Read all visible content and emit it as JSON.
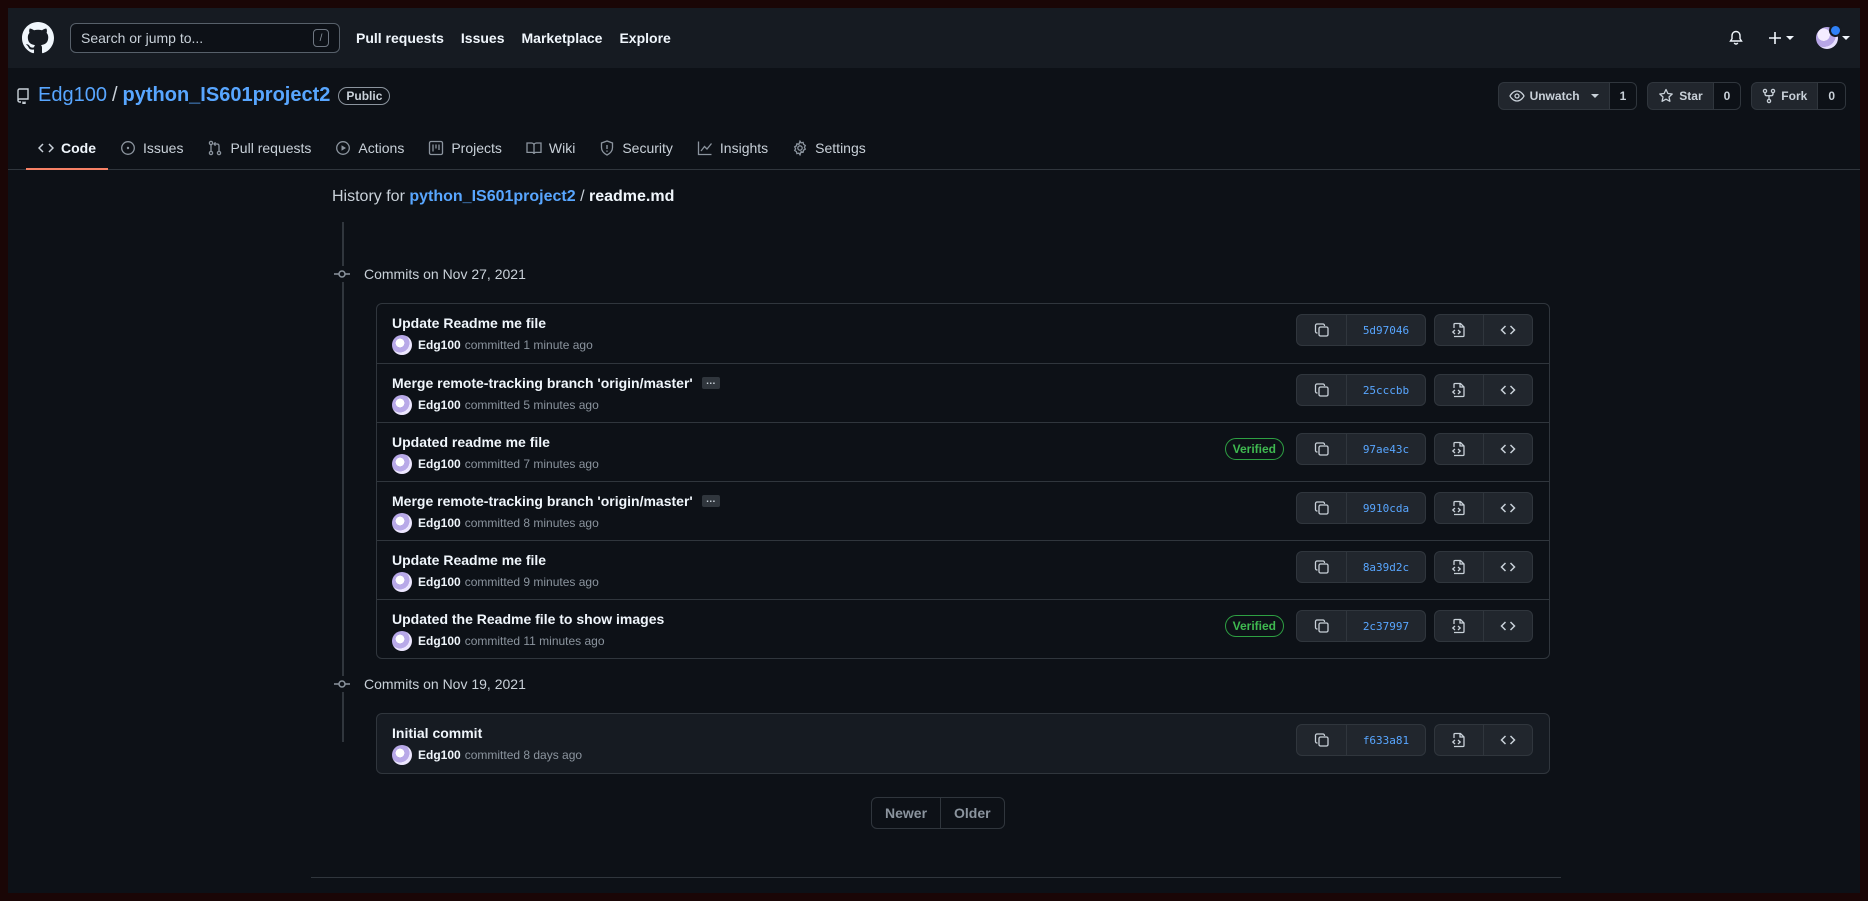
{
  "header": {
    "search_placeholder": "Search or jump to...",
    "search_shortcut": "/",
    "nav": [
      "Pull requests",
      "Issues",
      "Marketplace",
      "Explore"
    ]
  },
  "repo": {
    "owner": "Edg100",
    "separator": "/",
    "name": "python_IS601project2",
    "visibility": "Public",
    "watch_label": "Unwatch",
    "watch_count": "1",
    "star_label": "Star",
    "star_count": "0",
    "fork_label": "Fork",
    "fork_count": "0"
  },
  "tabs": [
    {
      "label": "Code",
      "icon": "code-icon",
      "selected": true
    },
    {
      "label": "Issues",
      "icon": "issue-icon"
    },
    {
      "label": "Pull requests",
      "icon": "pull-request-icon"
    },
    {
      "label": "Actions",
      "icon": "play-icon"
    },
    {
      "label": "Projects",
      "icon": "project-icon"
    },
    {
      "label": "Wiki",
      "icon": "book-icon"
    },
    {
      "label": "Security",
      "icon": "shield-icon"
    },
    {
      "label": "Insights",
      "icon": "graph-icon"
    },
    {
      "label": "Settings",
      "icon": "gear-icon"
    }
  ],
  "history": {
    "prefix": "History for",
    "repo_link": "python_IS601project2",
    "sep": "/",
    "file": "readme.md"
  },
  "groups": [
    {
      "date": "Commits on Nov 27, 2021",
      "commits": [
        {
          "message": "Update Readme me file",
          "author": "Edg100",
          "time": "committed 1 minute ago",
          "sha": "5d97046"
        },
        {
          "message": "Merge remote-tracking branch 'origin/master'",
          "ellipsis": "…",
          "author": "Edg100",
          "time": "committed 5 minutes ago",
          "sha": "25cccbb"
        },
        {
          "message": "Updated readme me file",
          "author": "Edg100",
          "time": "committed 7 minutes ago",
          "sha": "97ae43c",
          "verified": "Verified"
        },
        {
          "message": "Merge remote-tracking branch 'origin/master'",
          "ellipsis": "…",
          "author": "Edg100",
          "time": "committed 8 minutes ago",
          "sha": "9910cda"
        },
        {
          "message": "Update Readme me file",
          "author": "Edg100",
          "time": "committed 9 minutes ago",
          "sha": "8a39d2c"
        },
        {
          "message": "Updated the Readme file to show images",
          "author": "Edg100",
          "time": "committed 11 minutes ago",
          "sha": "2c37997",
          "verified": "Verified"
        }
      ]
    },
    {
      "date": "Commits on Nov 19, 2021",
      "commits": [
        {
          "message": "Initial commit",
          "author": "Edg100",
          "time": "committed 8 days ago",
          "sha": "f633a81"
        }
      ]
    }
  ],
  "pagination": {
    "newer": "Newer",
    "older": "Older"
  },
  "colors": {
    "accent": "#f78166",
    "link": "#58a6ff",
    "verified": "#3fb950"
  }
}
